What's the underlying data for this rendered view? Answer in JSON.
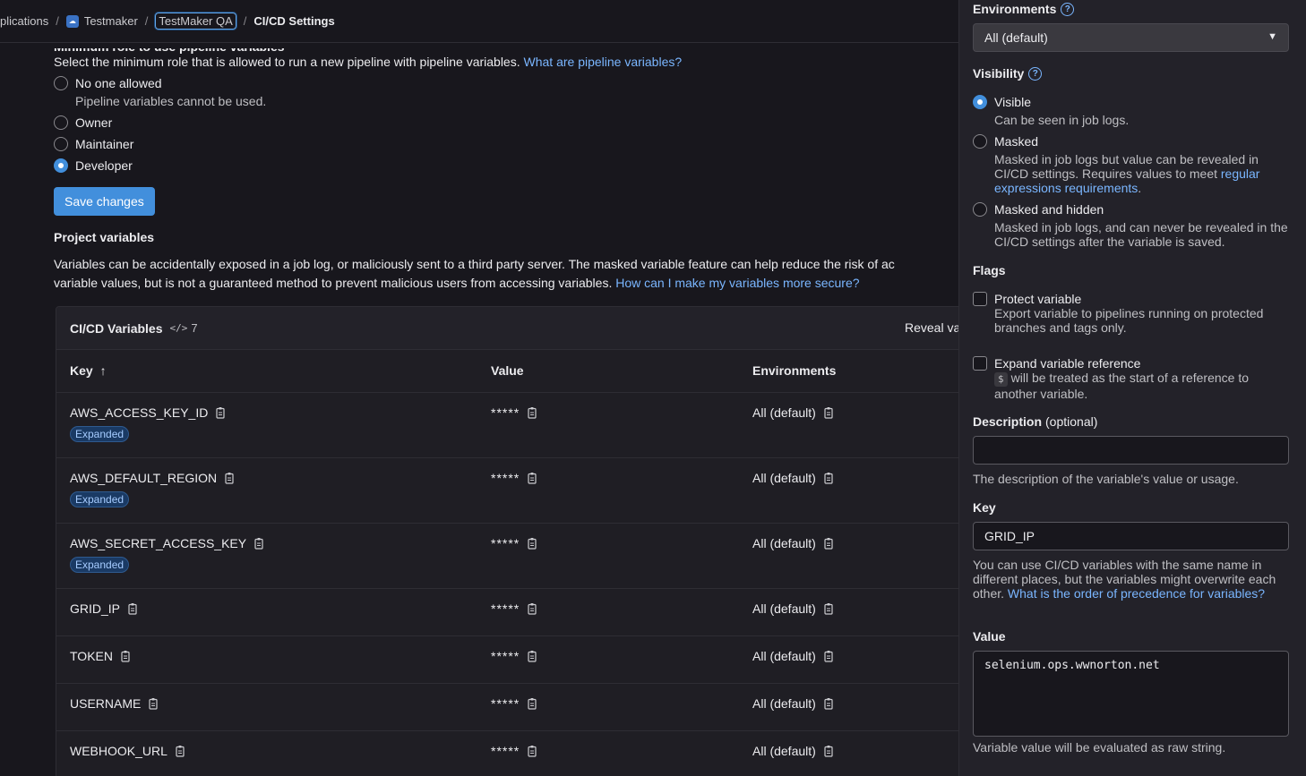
{
  "breadcrumb": {
    "items": [
      "plications",
      "Testmaker",
      "TestMaker QA",
      "CI/CD Settings"
    ],
    "separator": "/"
  },
  "pipeline_roles": {
    "heading_cutoff": "Minimum role to use pipeline variables",
    "description": "Select the minimum role that is allowed to run a new pipeline with pipeline variables.",
    "description_link": "What are pipeline variables?",
    "options": [
      {
        "label": "No one allowed",
        "help": "Pipeline variables cannot be used.",
        "checked": false
      },
      {
        "label": "Owner",
        "help": "",
        "checked": false
      },
      {
        "label": "Maintainer",
        "help": "",
        "checked": false
      },
      {
        "label": "Developer",
        "help": "",
        "checked": true
      }
    ],
    "save_label": "Save changes"
  },
  "project_variables": {
    "title": "Project variables",
    "desc_line1": "Variables can be accidentally exposed in a job log, or maliciously sent to a third party server. The masked variable feature can help reduce the risk of ac",
    "desc_line2": "variable values, but is not a guaranteed method to prevent malicious users from accessing variables.",
    "desc_link": "How can I make my variables more secure?"
  },
  "table": {
    "title": "CI/CD Variables",
    "count": "7",
    "reveal_label": "Reveal va",
    "headers": {
      "key": "Key",
      "sort_icon": "↑",
      "value": "Value",
      "environments": "Environments"
    },
    "rows": [
      {
        "key": "AWS_ACCESS_KEY_ID",
        "badge": "Expanded",
        "value": "*****",
        "env": "All (default)"
      },
      {
        "key": "AWS_DEFAULT_REGION",
        "badge": "Expanded",
        "value": "*****",
        "env": "All (default)"
      },
      {
        "key": "AWS_SECRET_ACCESS_KEY",
        "badge": "Expanded",
        "value": "*****",
        "env": "All (default)"
      },
      {
        "key": "GRID_IP",
        "badge": "",
        "value": "*****",
        "env": "All (default)"
      },
      {
        "key": "TOKEN",
        "badge": "",
        "value": "*****",
        "env": "All (default)"
      },
      {
        "key": "USERNAME",
        "badge": "",
        "value": "*****",
        "env": "All (default)"
      },
      {
        "key": "WEBHOOK_URL",
        "badge": "",
        "value": "*****",
        "env": "All (default)"
      }
    ]
  },
  "drawer": {
    "environments_label": "Environments",
    "environments_value": "All (default)",
    "visibility_label": "Visibility",
    "visibility_options": [
      {
        "label": "Visible",
        "help": "Can be seen in job logs.",
        "checked": true
      },
      {
        "label": "Masked",
        "help": "Masked in job logs but value can be revealed in CI/CD settings. Requires values to meet",
        "link": "regular expressions requirements",
        "after_link": ".",
        "checked": false
      },
      {
        "label": "Masked and hidden",
        "help": "Masked in job logs, and can never be revealed in the CI/CD settings after the variable is saved.",
        "checked": false
      }
    ],
    "flags_label": "Flags",
    "protect_label": "Protect variable",
    "protect_help": "Export variable to pipelines running on protected branches and tags only.",
    "expand_label": "Expand variable reference",
    "expand_dollar": "$",
    "expand_help": "will be treated as the start of a reference to another variable.",
    "description_label": "Description",
    "description_optional": "(optional)",
    "description_value": "",
    "description_hint": "The description of the variable's value or usage.",
    "key_label": "Key",
    "key_value": "GRID_IP",
    "key_hint": "You can use CI/CD variables with the same name in different places, but the variables might overwrite each other.",
    "key_hint_link": "What is the order of precedence for variables?",
    "value_label": "Value",
    "value_value": "selenium.ops.wwnorton.net",
    "value_hint": "Variable value will be evaluated as raw string."
  },
  "colors": {
    "accent": "#428fdc",
    "link": "#7ab6ff",
    "background": "#18171d",
    "drawer": "#232229"
  }
}
